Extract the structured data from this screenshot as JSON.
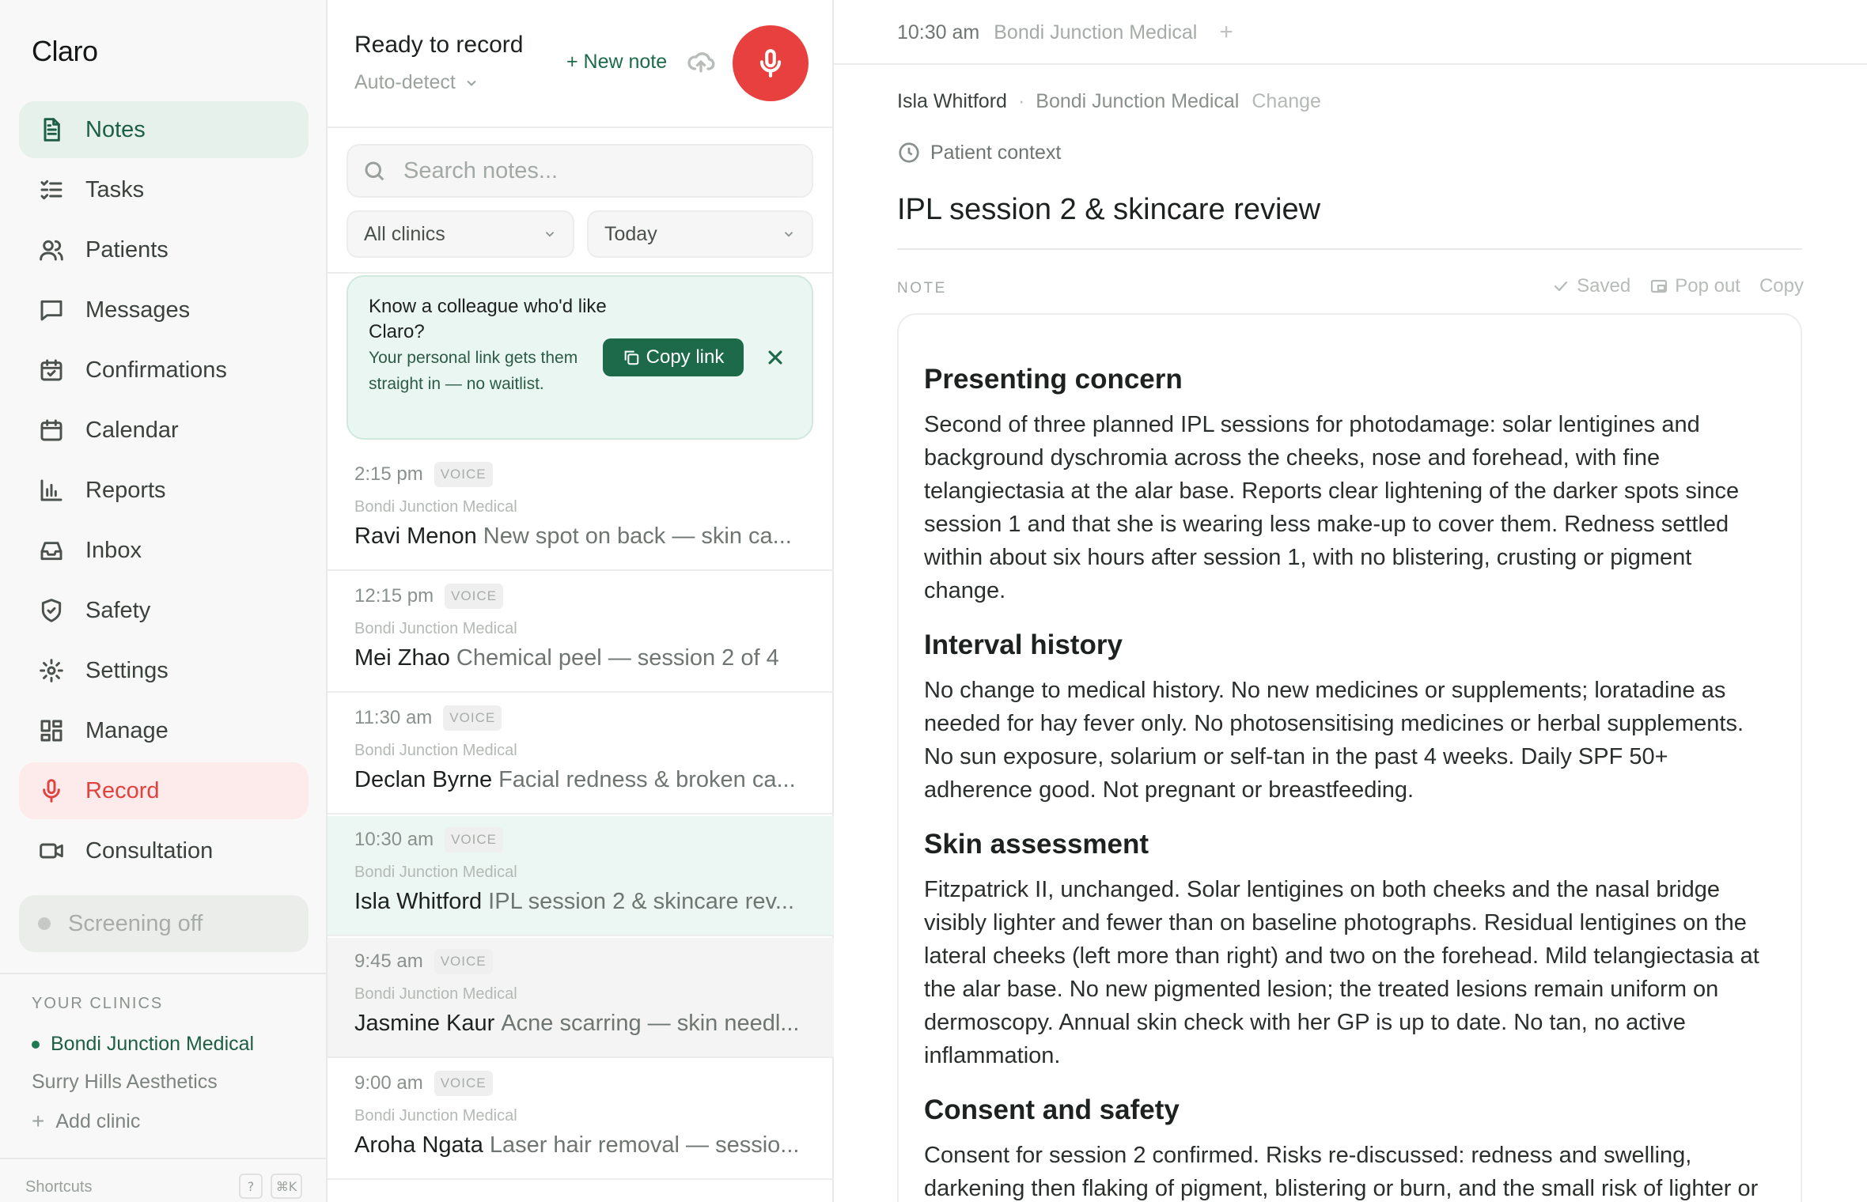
{
  "sidebar": {
    "brand": "Claro",
    "nav": [
      {
        "label": "Notes",
        "icon": "file-text-icon"
      },
      {
        "label": "Tasks",
        "icon": "checklist-icon"
      },
      {
        "label": "Patients",
        "icon": "users-icon"
      },
      {
        "label": "Messages",
        "icon": "message-icon"
      },
      {
        "label": "Confirmations",
        "icon": "calendar-check-icon"
      },
      {
        "label": "Calendar",
        "icon": "calendar-icon"
      },
      {
        "label": "Reports",
        "icon": "bar-chart-icon"
      },
      {
        "label": "Inbox",
        "icon": "inbox-icon"
      },
      {
        "label": "Safety",
        "icon": "shield-icon"
      },
      {
        "label": "Settings",
        "icon": "gear-icon"
      },
      {
        "label": "Manage",
        "icon": "grid-icon"
      },
      {
        "label": "Record",
        "icon": "mic-icon"
      },
      {
        "label": "Consultation",
        "icon": "video-icon"
      }
    ],
    "active_item": "Notes",
    "screening": "Screening off",
    "clinics_label": "YOUR CLINICS",
    "clinics": [
      "Bondi Junction Medical",
      "Surry Hills Aesthetics"
    ],
    "active_clinic": "Bondi Junction Medical",
    "add_clinic": "Add clinic",
    "shortcuts_label": "Shortcuts",
    "shortcut_keys": [
      "?",
      "⌘K"
    ]
  },
  "recorder": {
    "status": "Ready to record",
    "mode": "Auto-detect",
    "new_note": "+ New note"
  },
  "search": {
    "placeholder": "Search notes..."
  },
  "filters": {
    "clinic": "All clinics",
    "date": "Today"
  },
  "referral": {
    "title": "Know a colleague who'd like Claro?",
    "body": "Your personal link gets them straight in — no waitlist.",
    "button": "Copy link"
  },
  "notes": [
    {
      "time": "2:15 pm",
      "badge": "VOICE",
      "clinic": "Bondi Junction Medical",
      "patient": "Ravi Menon",
      "summary": "New spot on back — skin ca..."
    },
    {
      "time": "12:15 pm",
      "badge": "VOICE",
      "clinic": "Bondi Junction Medical",
      "patient": "Mei Zhao",
      "summary": "Chemical peel — session 2 of 4"
    },
    {
      "time": "11:30 am",
      "badge": "VOICE",
      "clinic": "Bondi Junction Medical",
      "patient": "Declan Byrne",
      "summary": "Facial redness & broken ca..."
    },
    {
      "time": "10:30 am",
      "badge": "VOICE",
      "clinic": "Bondi Junction Medical",
      "patient": "Isla Whitford",
      "summary": "IPL session 2 & skincare rev..."
    },
    {
      "time": "9:45 am",
      "badge": "VOICE",
      "clinic": "Bondi Junction Medical",
      "patient": "Jasmine Kaur",
      "summary": "Acne scarring — skin needl..."
    },
    {
      "time": "9:00 am",
      "badge": "VOICE",
      "clinic": "Bondi Junction Medical",
      "patient": "Aroha Ngata",
      "summary": "Laser hair removal — sessio..."
    }
  ],
  "detail": {
    "time": "10:30 am",
    "clinic": "Bondi Junction Medical",
    "patient": "Isla Whitford",
    "separator": "·",
    "change": "Change",
    "context": "Patient context",
    "title": "IPL session 2 & skincare review",
    "note_label": "NOTE",
    "actions": {
      "saved": "Saved",
      "pop_out": "Pop out",
      "copy": "Copy"
    },
    "sections": [
      {
        "heading": "Presenting concern",
        "body": "Second of three planned IPL sessions for photodamage: solar lentigines and background dyschromia across the cheeks, nose and forehead, with fine telangiectasia at the alar base. Reports clear lightening of the darker spots since session 1 and that she is wearing less make-up to cover them. Redness settled within about six hours after session 1, with no blistering, crusting or pigment change."
      },
      {
        "heading": "Interval history",
        "body": "No change to medical history. No new medicines or supplements; loratadine as needed for hay fever only. No photosensitising medicines or herbal supplements. No sun exposure, solarium or self-tan in the past 4 weeks. Daily SPF 50+ adherence good. Not pregnant or breastfeeding."
      },
      {
        "heading": "Skin assessment",
        "body": "Fitzpatrick II, unchanged. Solar lentigines on both cheeks and the nasal bridge visibly lighter and fewer than on baseline photographs. Residual lentigines on the lateral cheeks (left more than right) and two on the forehead. Mild telangiectasia at the alar base. No new pigmented lesion; the treated lesions remain uniform on dermoscopy. Annual skin check with her GP is up to date. No tan, no active inflammation."
      },
      {
        "heading": "Consent and safety",
        "body": "Consent for session 2 confirmed. Risks re-discussed: redness and swelling, darkening then flaking of pigment, blistering or burn, and the small risk of lighter or darker patches."
      }
    ]
  },
  "colors": {
    "accent": "#1d6a4a",
    "record_red": "#e8403e",
    "selected_row": "#ecf6f2"
  }
}
